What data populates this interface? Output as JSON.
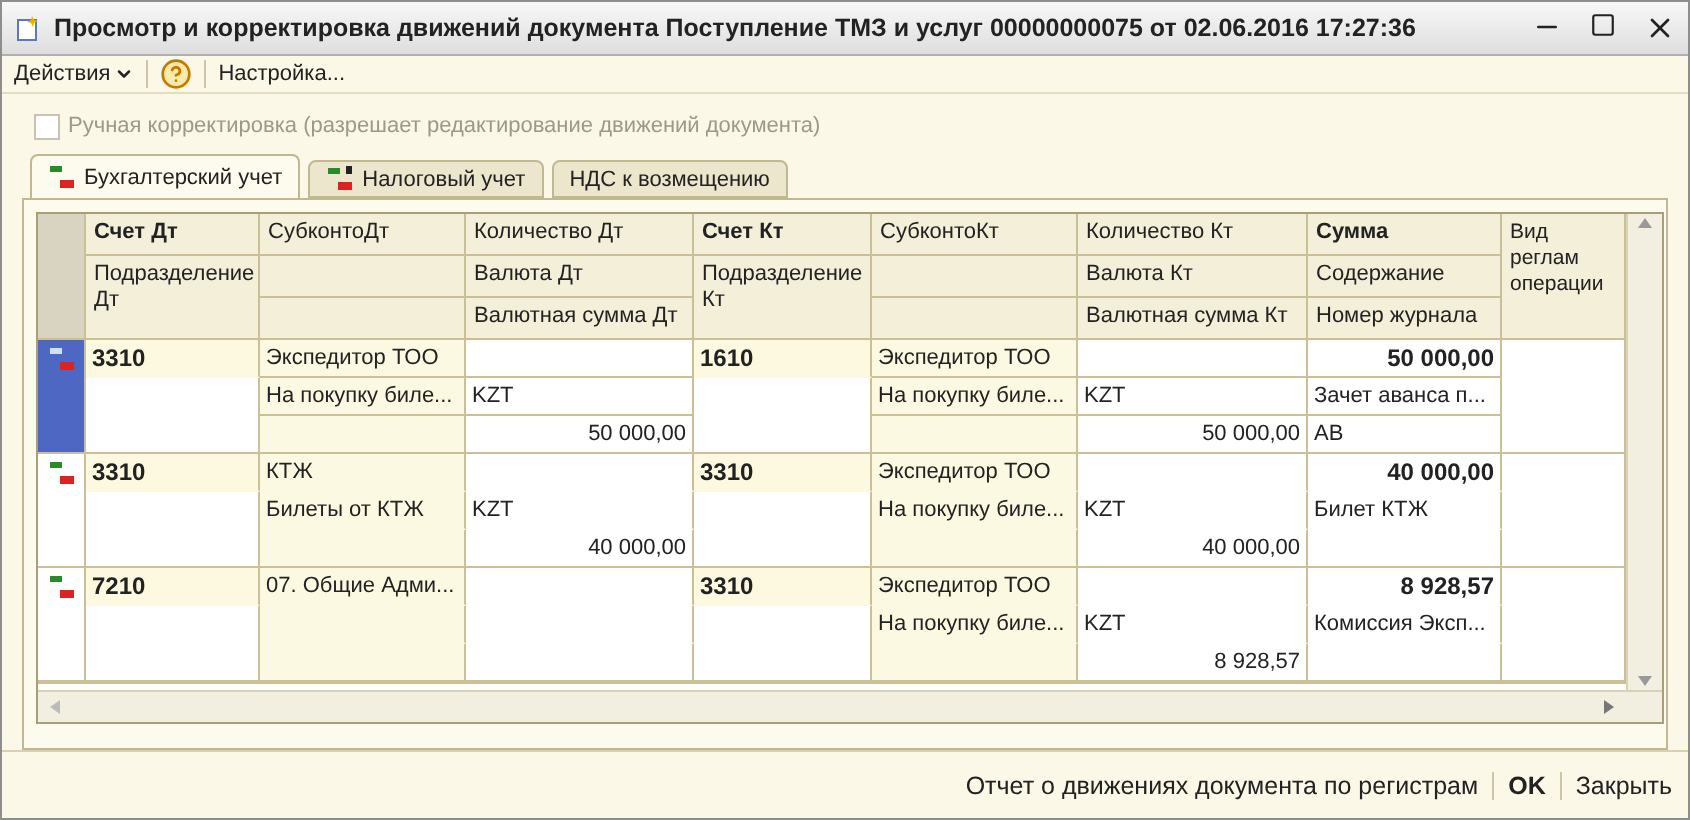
{
  "window": {
    "title": "Просмотр и корректировка движений документа Поступление ТМЗ и услуг 00000000075 от 02.06.2016 17:27:36"
  },
  "toolbar": {
    "actions": "Действия",
    "settings": "Настройка..."
  },
  "manual_edit": {
    "label": "Ручная корректировка (разрешает редактирование движений документа)",
    "checked": false,
    "disabled": true
  },
  "tabs": [
    {
      "label": "Бухгалтерский учет",
      "selected": true
    },
    {
      "label": "Налоговый учет",
      "selected": false
    },
    {
      "label": "НДС к возмещению",
      "selected": false
    }
  ],
  "table": {
    "columns": [
      {
        "kind": "account",
        "lines": [
          "Счет Дт",
          "Подразделение Дт"
        ],
        "bold": true
      },
      {
        "kind": "stack",
        "lines": [
          "СубконтоДт"
        ],
        "bold": false
      },
      {
        "kind": "stack",
        "lines": [
          "Количество Дт",
          "Валюта Дт",
          "Валютная сумма Дт"
        ],
        "bold": false
      },
      {
        "kind": "account",
        "lines": [
          "Счет Кт",
          "Подразделение Кт"
        ],
        "bold": true
      },
      {
        "kind": "stack",
        "lines": [
          "СубконтоКт"
        ],
        "bold": false
      },
      {
        "kind": "stack",
        "lines": [
          "Количество Кт",
          "Валюта Кт",
          "Валютная сумма Кт"
        ],
        "bold": false
      },
      {
        "kind": "stack",
        "lines": [
          "Сумма",
          "Содержание",
          "Номер журнала"
        ],
        "bold": true
      },
      {
        "kind": "tall",
        "lines": [
          "Вид реглам операции"
        ],
        "bold": false
      }
    ],
    "rows": [
      {
        "selected": true,
        "debit": {
          "account": "3310",
          "subconto": [
            "Экспедитор ТОО",
            "На покупку биле..."
          ],
          "currency": "KZT",
          "currency_amount": "50 000,00"
        },
        "credit": {
          "account": "1610",
          "subconto": [
            "Экспедитор ТОО",
            "На покупку биле..."
          ],
          "currency": "KZT",
          "currency_amount": "50 000,00"
        },
        "amount": "50 000,00",
        "content": "Зачет аванса п...",
        "journal": "АВ"
      },
      {
        "selected": false,
        "debit": {
          "account": "3310",
          "subconto": [
            "КТЖ",
            "Билеты от КТЖ"
          ],
          "currency": "KZT",
          "currency_amount": "40 000,00"
        },
        "credit": {
          "account": "3310",
          "subconto": [
            "Экспедитор ТОО",
            "На покупку биле..."
          ],
          "currency": "KZT",
          "currency_amount": "40 000,00"
        },
        "amount": "40 000,00",
        "content": "Билет КТЖ"
      },
      {
        "selected": false,
        "debit": {
          "account": "7210",
          "subconto": [
            "07. Общие Адми..."
          ]
        },
        "credit": {
          "account": "3310",
          "subconto": [
            "Экспедитор ТОО",
            "На покупку биле..."
          ],
          "currency": "KZT",
          "currency_amount": "8 928,57"
        },
        "amount": "8 928,57",
        "content": "Комиссия Эксп..."
      }
    ]
  },
  "footer": {
    "report": "Отчет о движениях документа по регистрам",
    "ok": "OK",
    "close": "Закрыть"
  }
}
